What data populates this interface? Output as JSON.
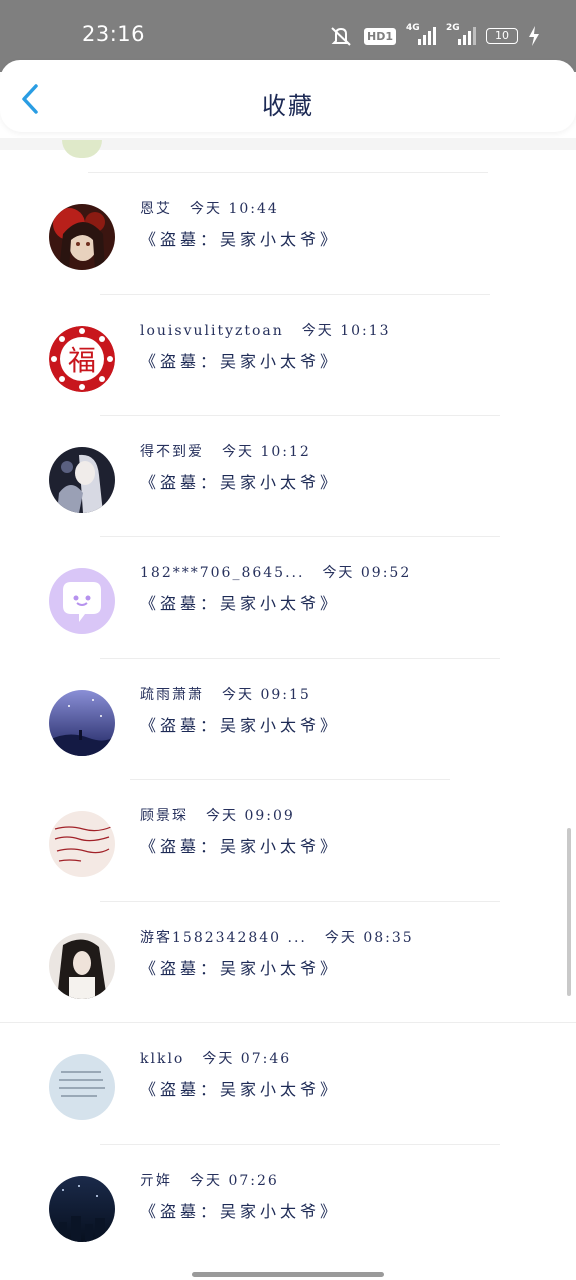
{
  "status": {
    "time": "23:16",
    "hd": "HD1",
    "net1": "4G",
    "net2": "2G",
    "battery": "10"
  },
  "header": {
    "title": "收藏"
  },
  "items": [
    {
      "name": "恩艾",
      "time": "今天 10:44",
      "book": "《盗墓：吴家小太爷》",
      "avatar": "anime-girl-red"
    },
    {
      "name": "louisvulityztoan",
      "time": "今天 10:13",
      "book": "《盗墓：吴家小太爷》",
      "avatar": "fu-character"
    },
    {
      "name": "得不到爱",
      "time": "今天 10:12",
      "book": "《盗墓：吴家小太爷》",
      "avatar": "anime-dark"
    },
    {
      "name": "182***706_8645...",
      "time": "今天 09:52",
      "book": "《盗墓：吴家小太爷》",
      "avatar": "default-chat"
    },
    {
      "name": "疏雨萧萧",
      "time": "今天 09:15",
      "book": "《盗墓：吴家小太爷》",
      "avatar": "night-sky"
    },
    {
      "name": "顾景琛",
      "time": "今天 09:09",
      "book": "《盗墓：吴家小太爷》",
      "avatar": "handwriting"
    },
    {
      "name": "游客1582342840 ...",
      "time": "今天 08:35",
      "book": "《盗墓：吴家小太爷》",
      "avatar": "anime-long-hair"
    },
    {
      "name": "klklo",
      "time": "今天 07:46",
      "book": "《盗墓：吴家小太爷》",
      "avatar": "text-note"
    },
    {
      "name": "亓姩",
      "time": "今天 07:26",
      "book": "《盗墓：吴家小太爷》",
      "avatar": "night-town"
    }
  ]
}
